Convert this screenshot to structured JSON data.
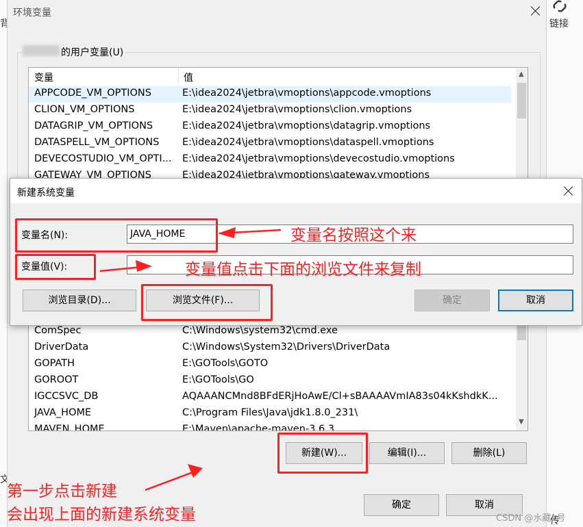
{
  "background_app": {
    "left_fragment_1": "背",
    "left_fragment_2": "文",
    "right_link_label": "链接",
    "right_fragment": "传"
  },
  "env_dialog": {
    "title": "环境变量",
    "user_vars_group_suffix": "的用户变量(U)",
    "columns": [
      "变量",
      "值"
    ],
    "user_vars": [
      {
        "name": "APPCODE_VM_OPTIONS",
        "value": "E:\\idea2024\\jetbra\\vmoptions\\appcode.vmoptions"
      },
      {
        "name": "CLION_VM_OPTIONS",
        "value": "E:\\idea2024\\jetbra\\vmoptions\\clion.vmoptions"
      },
      {
        "name": "DATAGRIP_VM_OPTIONS",
        "value": "E:\\idea2024\\jetbra\\vmoptions\\datagrip.vmoptions"
      },
      {
        "name": "DATASPELL_VM_OPTIONS",
        "value": "E:\\idea2024\\jetbra\\vmoptions\\dataspell.vmoptions"
      },
      {
        "name": "DEVECOSTUDIO_VM_OPTI...",
        "value": "E:\\idea2024\\jetbra\\vmoptions\\devecostudio.vmoptions"
      },
      {
        "name": "GATEWAY_VM_OPTIONS",
        "value": "E:\\idea2024\\jetbra\\vmoptions\\gateway.vmoptions"
      }
    ],
    "system_vars": [
      {
        "name": "ComSpec",
        "value": "C:\\Windows\\system32\\cmd.exe"
      },
      {
        "name": "DriverData",
        "value": "C:\\Windows\\System32\\Drivers\\DriverData"
      },
      {
        "name": "GOPATH",
        "value": "E:\\GOTools\\GOTO"
      },
      {
        "name": "GOROOT",
        "value": "E:\\GOTools\\GO"
      },
      {
        "name": "IGCCSVC_DB",
        "value": "AQAAANCMnd8BFdERjHoAwE/Cl+sBAAAAVmIA83s04kKshdkK..."
      },
      {
        "name": "JAVA_HOME",
        "value": "C:\\Program Files\\Java\\jdk1.8.0_231\\"
      },
      {
        "name": "MAVEN_HOME",
        "value": "E:\\Maven\\apache-maven-3.6.3"
      }
    ],
    "buttons": {
      "new": "新建(W)...",
      "edit": "编辑(I)...",
      "delete": "删除(L)",
      "ok": "确定",
      "cancel": "取消"
    }
  },
  "new_var_dialog": {
    "title": "新建系统变量",
    "name_label": "变量名(N):",
    "value_label": "变量值(V):",
    "name_value": "JAVA_HOME",
    "value_value": "",
    "buttons": {
      "browse_dir": "浏览目录(D)...",
      "browse_file": "浏览文件(F)...",
      "ok": "确定",
      "cancel": "取消"
    }
  },
  "annotations": {
    "name_hint": "变量名按照这个来",
    "value_hint": "变量值点击下面的浏览文件来复制",
    "step_line1": "第一步点击新建",
    "step_line2": "会出现上面的新建系统变量",
    "color": "#ff1f1f"
  },
  "watermark": "CSDN @水藏1号"
}
